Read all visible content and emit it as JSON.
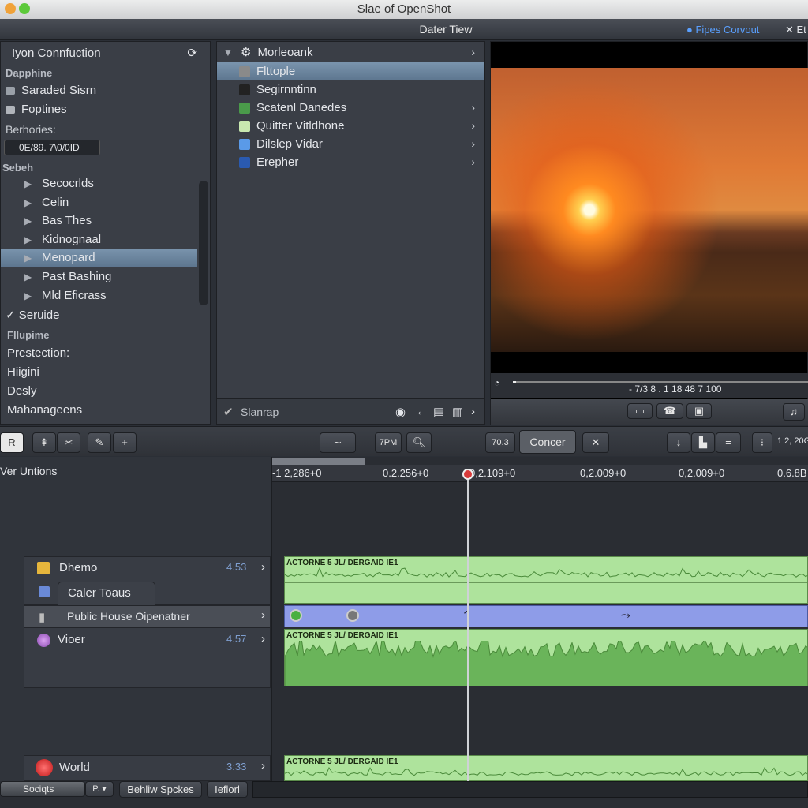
{
  "window": {
    "title": "Slae of OpenShot",
    "traffic_lights": [
      "#f0a23a",
      "#5cc93a"
    ]
  },
  "toolbar": {
    "title": "Dater Tiew",
    "right_link": "Fipes Corvout",
    "right_close": "✕ Et",
    "accent": "#5aa0ff"
  },
  "left_panel": {
    "header": "Iyon Connfuction",
    "section1": "Dapphine",
    "items1": [
      "Saraded Sisrn",
      "Foptines"
    ],
    "field_label": "Berhories:",
    "field_value": "0E/89. 7\\0/0ID",
    "section2": "Sebeh",
    "tree": [
      {
        "label": "Secocrlds"
      },
      {
        "label": "Celin"
      },
      {
        "label": "Bas Thes"
      },
      {
        "label": "Kidnognaal"
      },
      {
        "label": "Menopard",
        "selected": true
      },
      {
        "label": "Past Bashing"
      },
      {
        "label": "Mld Eficrass"
      }
    ],
    "checked_item": "Seruide",
    "section3": "Fllupime",
    "items3": [
      "Prestection:",
      "Hiigini",
      "Desly",
      "Mahanageens"
    ]
  },
  "media_panel": {
    "root": "Morleoank",
    "items": [
      {
        "label": "Flttople",
        "icon": "folder-icon",
        "selected": true,
        "chevron": false
      },
      {
        "label": "Segirnntinn",
        "icon": "drive-icon",
        "chevron": false
      },
      {
        "label": "Scatenl Danedes",
        "icon": "image-icon",
        "chevron": true
      },
      {
        "label": "Quitter Vitldhone",
        "icon": "document-icon",
        "chevron": true
      },
      {
        "label": "Dilslep Vidar",
        "icon": "folder-blue-icon",
        "chevron": true
      },
      {
        "label": "Erepher",
        "icon": "picture-icon",
        "chevron": true
      }
    ],
    "footer": "Slanrap"
  },
  "preview": {
    "timecode": "- 7/3 8 . 1 18  48 7 100",
    "progress": 0.01
  },
  "timeline_toolbar": {
    "left_btn": "R",
    "btn_7pm": "7PM",
    "btn_703": "70.3",
    "concer": "Concer",
    "right_value": "1 2, 20G"
  },
  "timeline": {
    "header_label": "Ver Untions",
    "ruler_ticks": [
      "-1 2,286+0",
      "0.2.256+0",
      "0,2.109+0",
      "0,2.009+0",
      "0,2.009+0",
      "0.6.8B"
    ],
    "tracks": [
      {
        "name": "Dhemo",
        "value": "4.53",
        "icon_color": "#e6b63c"
      },
      {
        "name": "Caler Toaus"
      },
      {
        "name": "Public House Oipenatner"
      },
      {
        "name": "Vioer",
        "value": "4.57",
        "icon_color": "#b06ad0"
      },
      {
        "name": "World",
        "value": "3:33",
        "icon_color": "#d23a3a"
      }
    ],
    "clip_label": "ACTORNE 5 JL/ DERGAID IE1",
    "clip_color": "#9fdc8a",
    "audio_clip_color": "#8e9ce8"
  },
  "bottom_bar": {
    "select": "Sociqts",
    "select_btn": "P.",
    "btn1": "Behliw Spckes",
    "btn2": "Ieflorl"
  }
}
